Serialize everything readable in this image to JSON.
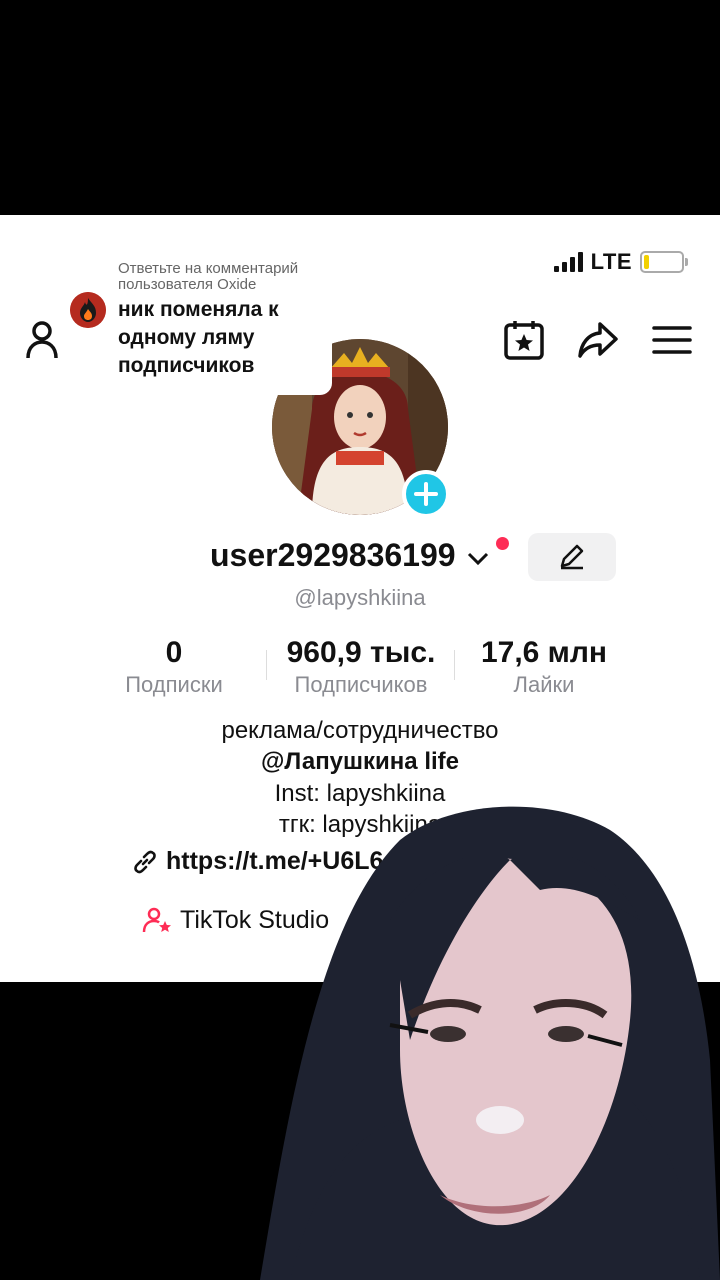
{
  "status_bar": {
    "network": "LTE",
    "battery_level": 0.12
  },
  "reply_bubble": {
    "header": "Ответьте на комментарий пользователя Oxide",
    "text": "ник поменяла к одному ляму подписчиков"
  },
  "profile": {
    "username": "user2929836199",
    "handle": "@lapyshkiina",
    "stats": [
      {
        "value": "0",
        "label": "Подписки"
      },
      {
        "value": "960,9 тыс.",
        "label": "Подписчиков"
      },
      {
        "value": "17,6 млн",
        "label": "Лайки"
      }
    ],
    "bio": [
      "реклама/сотрудничество",
      "@Лапушкина life",
      "Inst: lapyshkiina",
      "тгк: lapyshkiina"
    ],
    "link": "https://t.me/+U6L6",
    "studio_label": "TikTok Studio"
  },
  "colors": {
    "accent_pink": "#fe2c55",
    "accent_cyan": "#20c6e6"
  },
  "icons": [
    "add-user-icon",
    "calendar-star-icon",
    "share-icon",
    "menu-icon",
    "pencil-icon",
    "link-icon",
    "studio-icon",
    "plus-icon",
    "chevron-down-icon"
  ]
}
